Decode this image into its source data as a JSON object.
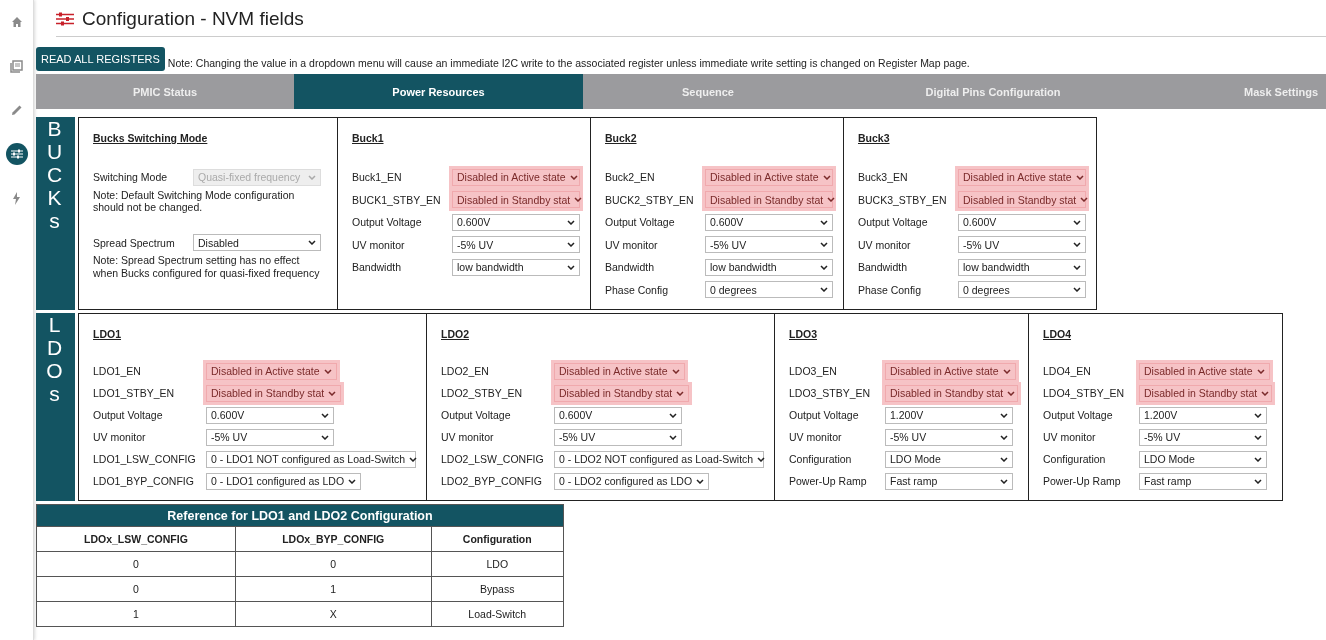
{
  "sidebar": {
    "items": [
      {
        "kind": "home",
        "selected": false
      },
      {
        "kind": "book",
        "selected": false
      },
      {
        "kind": "pencil",
        "selected": false
      },
      {
        "kind": "sliders",
        "selected": true
      },
      {
        "kind": "bolt",
        "selected": false
      }
    ]
  },
  "title": "Configuration - NVM fields",
  "read_button": "READ ALL REGISTERS",
  "note": "Note: Changing the value in a dropdown menu will cause an immediate I2C write to the associated register unless immediate write setting is changed on Register Map page.",
  "tabs": [
    {
      "label": "PMIC Status",
      "selected": false
    },
    {
      "label": "Power Resources",
      "selected": true
    },
    {
      "label": "Sequence",
      "selected": false
    },
    {
      "label": "Digital Pins Configuration",
      "selected": false
    },
    {
      "label": "Mask Settings",
      "selected": false
    }
  ],
  "sections": [
    {
      "label": "BUCKs",
      "panels": [
        {
          "title": "Bucks Switching Mode",
          "items": [
            {
              "kind": "select",
              "label": "Switching Mode",
              "value": "Quasi-fixed frequency",
              "highlighted": false,
              "disabled": true
            },
            {
              "kind": "note",
              "text": "Note: Default Switching Mode configuration should not be changed."
            },
            {
              "kind": "select",
              "label": "Spread Spectrum",
              "value": "Disabled",
              "highlighted": false,
              "disabled": false
            },
            {
              "kind": "note",
              "text": "Note: Spread Spectrum setting has no effect when Bucks configured for quasi-fixed frequency"
            }
          ]
        },
        {
          "title": "Buck1",
          "items": [
            {
              "kind": "select",
              "label": "Buck1_EN",
              "value": "Disabled in Active state",
              "highlighted": true,
              "disabled": false
            },
            {
              "kind": "select",
              "label": "BUCK1_STBY_EN",
              "value": "Disabled in Standby stat",
              "highlighted": true,
              "disabled": false
            },
            {
              "kind": "select",
              "label": "Output Voltage",
              "value": "0.600V",
              "highlighted": false,
              "disabled": false
            },
            {
              "kind": "select",
              "label": "UV monitor",
              "value": "-5% UV",
              "highlighted": false,
              "disabled": false
            },
            {
              "kind": "select",
              "label": "Bandwidth",
              "value": "low bandwidth",
              "highlighted": false,
              "disabled": false
            }
          ]
        },
        {
          "title": "Buck2",
          "items": [
            {
              "kind": "select",
              "label": "Buck2_EN",
              "value": "Disabled in Active state",
              "highlighted": true,
              "disabled": false
            },
            {
              "kind": "select",
              "label": "BUCK2_STBY_EN",
              "value": "Disabled in Standby stat",
              "highlighted": true,
              "disabled": false
            },
            {
              "kind": "select",
              "label": "Output Voltage",
              "value": "0.600V",
              "highlighted": false,
              "disabled": false
            },
            {
              "kind": "select",
              "label": "UV monitor",
              "value": "-5% UV",
              "highlighted": false,
              "disabled": false
            },
            {
              "kind": "select",
              "label": "Bandwidth",
              "value": "low bandwidth",
              "highlighted": false,
              "disabled": false
            },
            {
              "kind": "select",
              "label": "Phase Config",
              "value": "0 degrees",
              "highlighted": false,
              "disabled": false
            }
          ]
        },
        {
          "title": "Buck3",
          "items": [
            {
              "kind": "select",
              "label": "Buck3_EN",
              "value": "Disabled in Active state",
              "highlighted": true,
              "disabled": false
            },
            {
              "kind": "select",
              "label": "BUCK3_STBY_EN",
              "value": "Disabled in Standby stat",
              "highlighted": true,
              "disabled": false
            },
            {
              "kind": "select",
              "label": "Output Voltage",
              "value": "0.600V",
              "highlighted": false,
              "disabled": false
            },
            {
              "kind": "select",
              "label": "UV monitor",
              "value": "-5% UV",
              "highlighted": false,
              "disabled": false
            },
            {
              "kind": "select",
              "label": "Bandwidth",
              "value": "low bandwidth",
              "highlighted": false,
              "disabled": false
            },
            {
              "kind": "select",
              "label": "Phase Config",
              "value": "0 degrees",
              "highlighted": false,
              "disabled": false
            }
          ]
        }
      ]
    },
    {
      "label": "LDOs",
      "panels": [
        {
          "title": "LDO1",
          "items": [
            {
              "kind": "select",
              "label": "LDO1_EN",
              "value": "Disabled in Active state",
              "highlighted": true,
              "disabled": false
            },
            {
              "kind": "select",
              "label": "LDO1_STBY_EN",
              "value": "Disabled in Standby stat",
              "highlighted": true,
              "disabled": false
            },
            {
              "kind": "select",
              "label": "Output Voltage",
              "value": "0.600V",
              "highlighted": false,
              "disabled": false
            },
            {
              "kind": "select",
              "label": "UV monitor",
              "value": "-5% UV",
              "highlighted": false,
              "disabled": false
            },
            {
              "kind": "select",
              "label": "LDO1_LSW_CONFIG",
              "value": "0 - LDO1 NOT configured as Load-Switch",
              "highlighted": false,
              "disabled": false
            },
            {
              "kind": "select",
              "label": "LDO1_BYP_CONFIG",
              "value": "0 - LDO1 configured as LDO",
              "highlighted": false,
              "disabled": false
            }
          ]
        },
        {
          "title": "LDO2",
          "items": [
            {
              "kind": "select",
              "label": "LDO2_EN",
              "value": "Disabled in Active state",
              "highlighted": true,
              "disabled": false
            },
            {
              "kind": "select",
              "label": "LDO2_STBY_EN",
              "value": "Disabled in Standby stat",
              "highlighted": true,
              "disabled": false
            },
            {
              "kind": "select",
              "label": "Output Voltage",
              "value": "0.600V",
              "highlighted": false,
              "disabled": false
            },
            {
              "kind": "select",
              "label": "UV monitor",
              "value": "-5% UV",
              "highlighted": false,
              "disabled": false
            },
            {
              "kind": "select",
              "label": "LDO2_LSW_CONFIG",
              "value": "0 - LDO2 NOT configured as Load-Switch",
              "highlighted": false,
              "disabled": false
            },
            {
              "kind": "select",
              "label": "LDO2_BYP_CONFIG",
              "value": "0 - LDO2 configured as LDO",
              "highlighted": false,
              "disabled": false
            }
          ]
        },
        {
          "title": "LDO3",
          "items": [
            {
              "kind": "select",
              "label": "LDO3_EN",
              "value": "Disabled in Active state",
              "highlighted": true,
              "disabled": false
            },
            {
              "kind": "select",
              "label": "LDO3_STBY_EN",
              "value": "Disabled in Standby stat",
              "highlighted": true,
              "disabled": false
            },
            {
              "kind": "select",
              "label": "Output Voltage",
              "value": "1.200V",
              "highlighted": false,
              "disabled": false
            },
            {
              "kind": "select",
              "label": "UV monitor",
              "value": "-5% UV",
              "highlighted": false,
              "disabled": false
            },
            {
              "kind": "select",
              "label": "Configuration",
              "value": "LDO Mode",
              "highlighted": false,
              "disabled": false
            },
            {
              "kind": "select",
              "label": "Power-Up Ramp",
              "value": "Fast ramp",
              "highlighted": false,
              "disabled": false
            }
          ]
        },
        {
          "title": "LDO4",
          "items": [
            {
              "kind": "select",
              "label": "LDO4_EN",
              "value": "Disabled in Active state",
              "highlighted": true,
              "disabled": false
            },
            {
              "kind": "select",
              "label": "LDO4_STBY_EN",
              "value": "Disabled in Standby stat",
              "highlighted": true,
              "disabled": false
            },
            {
              "kind": "select",
              "label": "Output Voltage",
              "value": "1.200V",
              "highlighted": false,
              "disabled": false
            },
            {
              "kind": "select",
              "label": "UV monitor",
              "value": "-5% UV",
              "highlighted": false,
              "disabled": false
            },
            {
              "kind": "select",
              "label": "Configuration",
              "value": "LDO Mode",
              "highlighted": false,
              "disabled": false
            },
            {
              "kind": "select",
              "label": "Power-Up Ramp",
              "value": "Fast ramp",
              "highlighted": false,
              "disabled": false
            }
          ]
        }
      ]
    }
  ],
  "reference_table": {
    "title": "Reference for LDO1 and LDO2 Configuration",
    "columns": [
      "LDOx_LSW_CONFIG",
      "LDOx_BYP_CONFIG",
      "Configuration"
    ],
    "rows": [
      [
        "0",
        "0",
        "LDO"
      ],
      [
        "0",
        "1",
        "Bypass"
      ],
      [
        "1",
        "X",
        "Load-Switch"
      ]
    ]
  }
}
